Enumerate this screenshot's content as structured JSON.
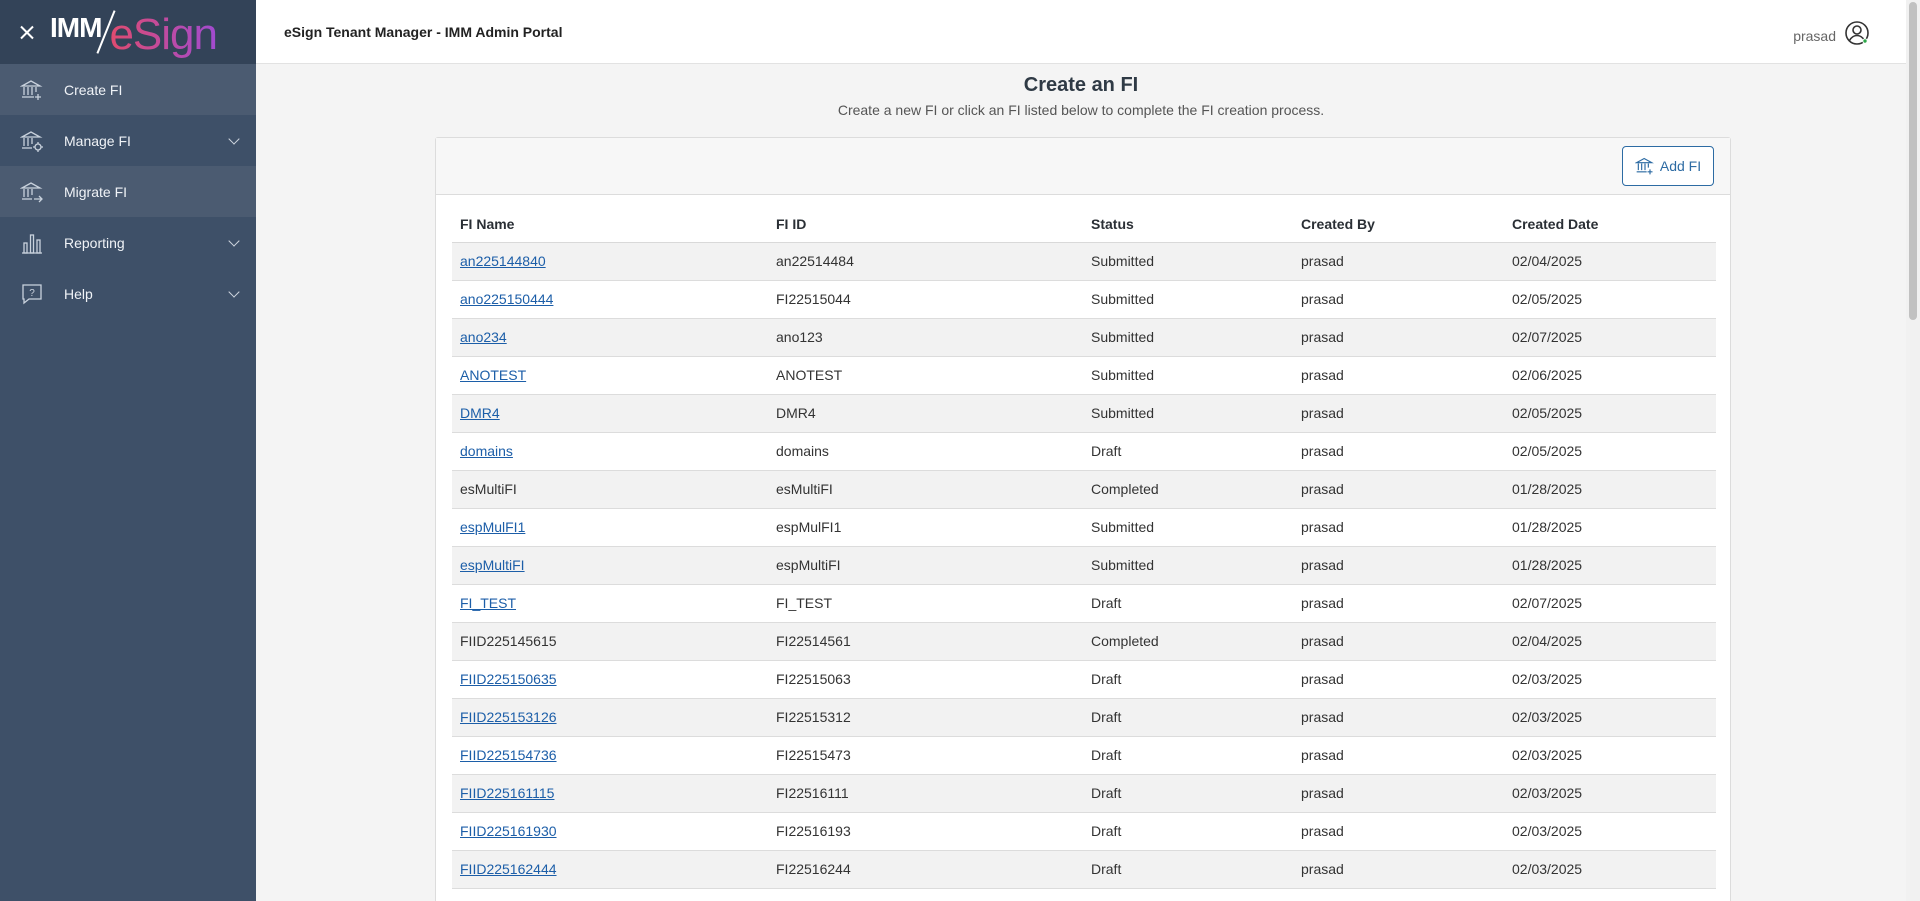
{
  "brand": {
    "imm": "IMM",
    "esign": "eSign"
  },
  "header": {
    "app_title": "eSign Tenant Manager - IMM Admin Portal",
    "user_name": "prasad"
  },
  "sidebar": {
    "items": [
      {
        "label": "Create FI",
        "icon": "bank-add-icon"
      },
      {
        "label": "Manage FI",
        "icon": "bank-gear-icon",
        "expandable": true
      },
      {
        "label": "Migrate FI",
        "icon": "bank-arrow-icon"
      },
      {
        "label": "Reporting",
        "icon": "bar-chart-icon",
        "expandable": true
      },
      {
        "label": "Help",
        "icon": "help-chat-icon",
        "expandable": true
      }
    ]
  },
  "main": {
    "title": "Create an FI",
    "subtitle": "Create a new FI or click an FI listed below to complete the FI creation process.",
    "add_button": "Add FI",
    "columns": [
      "FI Name",
      "FI ID",
      "Status",
      "Created By",
      "Created Date"
    ],
    "rows": [
      {
        "name": "an225144840",
        "link": true,
        "id": "an22514484",
        "status": "Submitted",
        "by": "prasad",
        "date": "02/04/2025"
      },
      {
        "name": "ano225150444",
        "link": true,
        "id": "FI22515044",
        "status": "Submitted",
        "by": "prasad",
        "date": "02/05/2025"
      },
      {
        "name": "ano234",
        "link": true,
        "id": "ano123",
        "status": "Submitted",
        "by": "prasad",
        "date": "02/07/2025"
      },
      {
        "name": "ANOTEST",
        "link": true,
        "id": "ANOTEST",
        "status": "Submitted",
        "by": "prasad",
        "date": "02/06/2025"
      },
      {
        "name": "DMR4",
        "link": true,
        "id": "DMR4",
        "status": "Submitted",
        "by": "prasad",
        "date": "02/05/2025"
      },
      {
        "name": "domains",
        "link": true,
        "id": "domains",
        "status": "Draft",
        "by": "prasad",
        "date": "02/05/2025"
      },
      {
        "name": "esMultiFI",
        "link": false,
        "id": "esMultiFI",
        "status": "Completed",
        "by": "prasad",
        "date": "01/28/2025"
      },
      {
        "name": "espMulFI1",
        "link": true,
        "id": "espMulFI1",
        "status": "Submitted",
        "by": "prasad",
        "date": "01/28/2025"
      },
      {
        "name": "espMultiFI",
        "link": true,
        "id": "espMultiFI",
        "status": "Submitted",
        "by": "prasad",
        "date": "01/28/2025"
      },
      {
        "name": "FI_TEST",
        "link": true,
        "id": "FI_TEST",
        "status": "Draft",
        "by": "prasad",
        "date": "02/07/2025"
      },
      {
        "name": "FIID225145615",
        "link": false,
        "id": "FI22514561",
        "status": "Completed",
        "by": "prasad",
        "date": "02/04/2025"
      },
      {
        "name": "FIID225150635",
        "link": true,
        "id": "FI22515063",
        "status": "Draft",
        "by": "prasad",
        "date": "02/03/2025"
      },
      {
        "name": "FIID225153126",
        "link": true,
        "id": "FI22515312",
        "status": "Draft",
        "by": "prasad",
        "date": "02/03/2025"
      },
      {
        "name": "FIID225154736",
        "link": true,
        "id": "FI22515473",
        "status": "Draft",
        "by": "prasad",
        "date": "02/03/2025"
      },
      {
        "name": "FIID225161115",
        "link": true,
        "id": "FI22516111",
        "status": "Draft",
        "by": "prasad",
        "date": "02/03/2025"
      },
      {
        "name": "FIID225161930",
        "link": true,
        "id": "FI22516193",
        "status": "Draft",
        "by": "prasad",
        "date": "02/03/2025"
      },
      {
        "name": "FIID225162444",
        "link": true,
        "id": "FI22516244",
        "status": "Draft",
        "by": "prasad",
        "date": "02/03/2025"
      },
      {
        "name": "",
        "link": false,
        "id": "",
        "status": "",
        "by": "",
        "date": ""
      }
    ]
  },
  "colors": {
    "sidebar_bg": "#3e5068",
    "sidebar_header": "#334358",
    "link": "#1c5ea8",
    "accent": "#2d6ba3"
  }
}
